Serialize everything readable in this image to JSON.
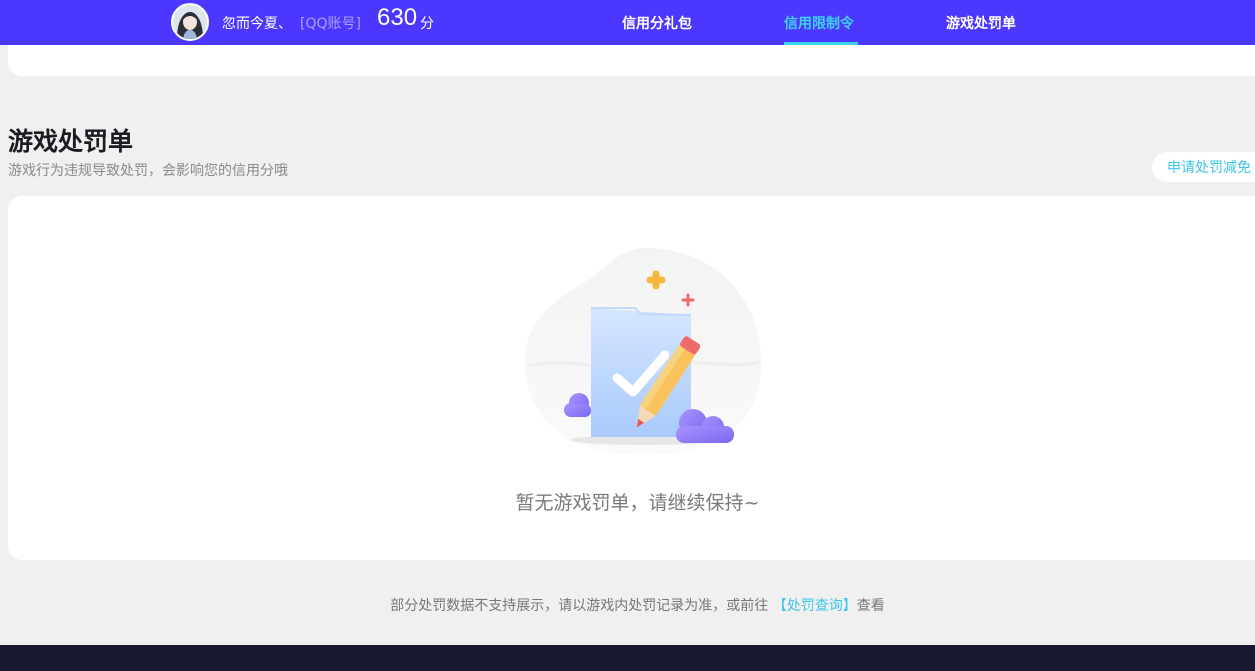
{
  "header": {
    "user_name": "忽而今夏、",
    "account_tag": "[QQ账号]",
    "score": "630",
    "score_unit": "分",
    "nav": [
      {
        "label": "信用分礼包",
        "active": false
      },
      {
        "label": "信用限制令",
        "active": true
      },
      {
        "label": "游戏处罚单",
        "active": false
      }
    ]
  },
  "section": {
    "title": "游戏处罚单",
    "subtitle": "游戏行为违规导致处罚，会影响您的信用分哦",
    "appeal_label": "申请处罚减免"
  },
  "empty_state": {
    "message": "暂无游戏罚单，请继续保持~"
  },
  "footnote": {
    "prefix": "部分处罚数据不支持展示，请以游戏内处罚记录为准，或前往",
    "link_label": "【处罚查询】",
    "suffix": "查看"
  },
  "colors": {
    "topbar": "#4c37ff",
    "active_nav": "#3ed3f0",
    "link": "#3ec6e8",
    "footer": "#1a1933"
  }
}
